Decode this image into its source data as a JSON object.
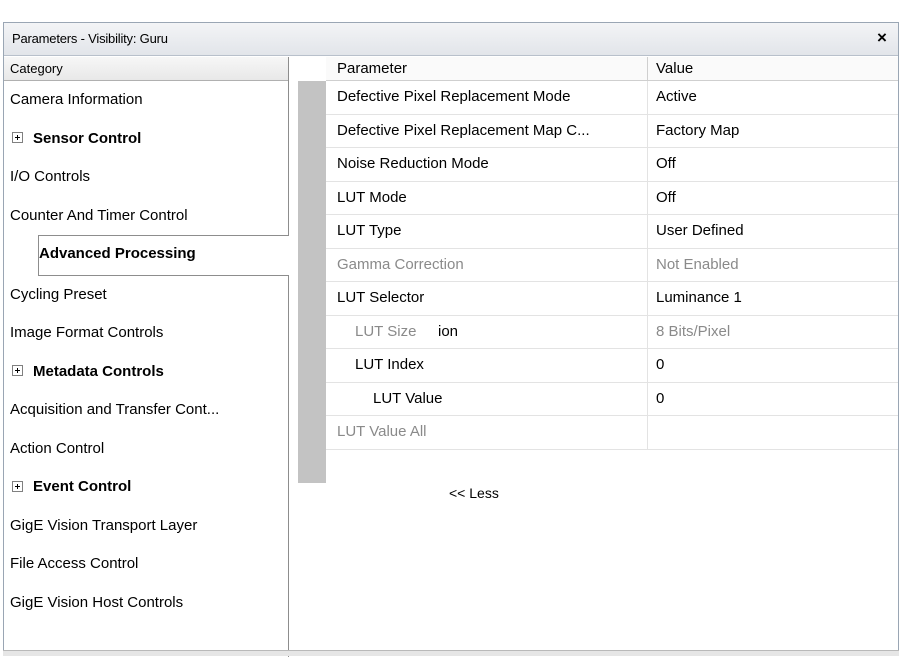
{
  "window": {
    "title": "Parameters - Visibility: Guru",
    "close_label": "×"
  },
  "category_panel": {
    "header": "Category",
    "items": [
      {
        "label": "Camera Information",
        "group": false
      },
      {
        "label": "Sensor Control",
        "group": true
      },
      {
        "label": "I/O Controls",
        "group": false
      },
      {
        "label": "Counter And Timer Control",
        "group": false
      },
      {
        "label": "Advanced Processing",
        "group": true,
        "selected": true
      },
      {
        "label": "Cycling Preset",
        "group": false
      },
      {
        "label": "Image Format Controls",
        "group": false
      },
      {
        "label": "Metadata Controls",
        "group": true
      },
      {
        "label": "Acquisition and Transfer Cont...",
        "group": false
      },
      {
        "label": "Action Control",
        "group": false
      },
      {
        "label": "Event Control",
        "group": true
      },
      {
        "label": "GigE Vision Transport Layer",
        "group": false
      },
      {
        "label": "File Access Control",
        "group": false
      },
      {
        "label": "GigE Vision Host Controls",
        "group": false
      }
    ]
  },
  "parameter_grid": {
    "columns": {
      "parameter": "Parameter",
      "value": "Value"
    },
    "rows": [
      {
        "name": "Defective Pixel Replacement Mode",
        "value": "Active",
        "level": 0,
        "enabled": true
      },
      {
        "name": "Defective Pixel Replacement Map C...",
        "value": "Factory Map",
        "level": 0,
        "enabled": true
      },
      {
        "name": "Noise Reduction Mode",
        "value": "Off",
        "level": 0,
        "enabled": true
      },
      {
        "name": "LUT Mode",
        "value": "Off",
        "level": 0,
        "enabled": true
      },
      {
        "name": "LUT Type",
        "value": "User Defined",
        "level": 0,
        "enabled": true
      },
      {
        "name": "Gamma Correction",
        "value": "Not Enabled",
        "level": 0,
        "enabled": false
      },
      {
        "name": "LUT Selector",
        "value": "Luminance 1",
        "level": 0,
        "enabled": true
      },
      {
        "name": "LUT Size",
        "value": "8 Bits/Pixel",
        "level": 1,
        "enabled": false,
        "overlay": "ion"
      },
      {
        "name": "LUT Index",
        "value": "0",
        "level": 1,
        "enabled": true
      },
      {
        "name": "LUT Value",
        "value": "0",
        "level": 2,
        "enabled": true
      },
      {
        "name": "LUT Value All",
        "value": "",
        "level": 0,
        "enabled": false
      }
    ],
    "less_link": "<< Less"
  },
  "colors": {
    "disabled_text": "#8a8a8a",
    "scroll_strip": "#c3c3c3",
    "panel_border": "#8d8d8d"
  }
}
